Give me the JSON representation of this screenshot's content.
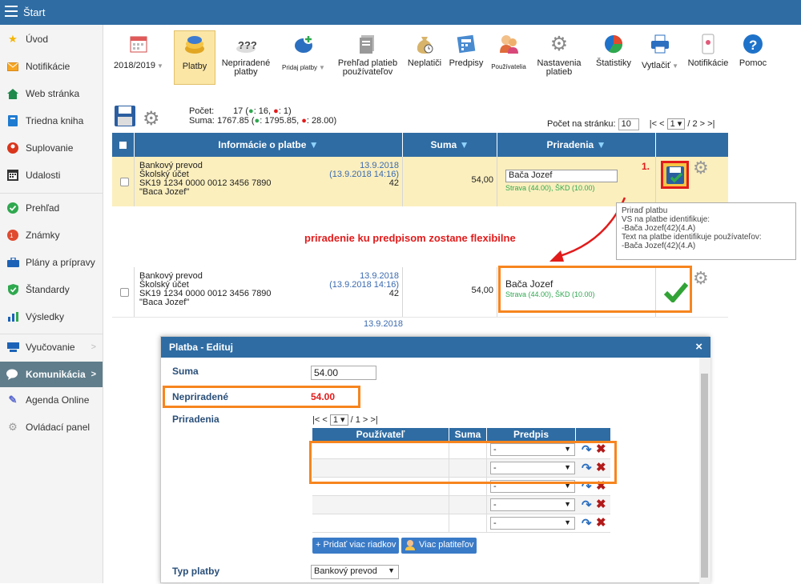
{
  "topbar": {
    "title": "Štart"
  },
  "sidebar": {
    "items": [
      {
        "label": "Úvod",
        "icon": "star-icon"
      },
      {
        "label": "Notifikácie",
        "icon": "envelope-icon"
      },
      {
        "label": "Web stránka",
        "icon": "home-icon"
      },
      {
        "label": "Triedna kniha",
        "icon": "book-icon"
      },
      {
        "label": "Suplovanie",
        "icon": "user-swap-icon"
      },
      {
        "label": "Udalosti",
        "icon": "calendar-icon"
      },
      {
        "label": "Prehľad",
        "icon": "check-circle-icon"
      },
      {
        "label": "Známky",
        "icon": "grades-icon"
      },
      {
        "label": "Plány a prípravy",
        "icon": "briefcase-icon"
      },
      {
        "label": "Štandardy",
        "icon": "shield-check-icon"
      },
      {
        "label": "Výsledky",
        "icon": "bar-chart-icon"
      },
      {
        "label": "Vyučovanie",
        "icon": "classroom-icon"
      },
      {
        "label": "Komunikácia",
        "icon": "chat-icon"
      },
      {
        "label": "Agenda Online",
        "icon": "pen-icon"
      },
      {
        "label": "Ovládací panel",
        "icon": "gear-icon"
      }
    ]
  },
  "toolbar": {
    "year": "2018/2019",
    "platby": "Platby",
    "nepriradene": "Nepriradené platby",
    "pridaj": "Pridaj platby",
    "prehlad": "Prehľad platieb používateľov",
    "neplatici": "Neplatiči",
    "predpisy": "Predpisy",
    "pouzivatelia": "Používatelia",
    "nastavenia": "Nastavenia platieb",
    "statistiky": "Štatistiky",
    "vytlacit": "Vytlačiť",
    "notifikacie": "Notifikácie",
    "pomoc": "Pomoc"
  },
  "summary": {
    "pocet_label": "Počet:",
    "pocet_value": "17 (",
    "pocet_plus": ": 16, ",
    "pocet_minus": ": 1)",
    "suma_label": "Suma:",
    "suma_value": "1767.85 (",
    "suma_plus": ": 1795.85, ",
    "suma_minus": ": 28.00)",
    "per_page_label": "Počet na stránku:",
    "per_page": "10",
    "page_first": "|<",
    "page_prev": "<",
    "page_current": "1",
    "page_total": "/ 2",
    "page_next": ">",
    "page_last": ">|"
  },
  "grid": {
    "headers": {
      "info": "Informácie o platbe",
      "suma": "Suma",
      "priradenia": "Priradenia"
    },
    "rows": [
      {
        "type": "Bankový prevod",
        "account_name": "Školský účet",
        "iban": "SK19 1234 0000 0012 3456 7890",
        "note": "\"Baca Jozef\"",
        "date": "13.9.2018",
        "datetime": "(13.9.2018 14:16)",
        "vs": "42",
        "amount": "54,00",
        "assignee": "Bača Jozef",
        "details": "Strava (44.00), ŠKD (10.00)"
      },
      {
        "type": "Bankový prevod",
        "account_name": "Školský účet",
        "iban": "SK19 1234 0000 0012 3456 7890",
        "note": "\"Baca Jozef\"",
        "date": "13.9.2018",
        "datetime": "(13.9.2018 14:16)",
        "vs": "42",
        "amount": "54,00",
        "assignee": "Bača Jozef",
        "details": "Strava (44.00), ŠKD (10.00)"
      }
    ],
    "next_row_partial": "13.9.2018"
  },
  "annotation": {
    "step": "1.",
    "text": "priradenie ku predpisom zostane flexibilne"
  },
  "tooltip": {
    "lines": [
      "Priraď platbu",
      "VS na platbe identifikuje:",
      "-Bača Jozef(42)(4.A)",
      "Text na platbe identifikuje používateľov:",
      "-Bača Jozef(42)(4.A)"
    ]
  },
  "dialog": {
    "title": "Platba - Edituj",
    "close": "×",
    "suma_label": "Suma",
    "suma_value": "54.00",
    "nepriradene_label": "Nepriradené",
    "nepriradene_value": "54.00",
    "priradenia_label": "Priradenia",
    "pager": {
      "first": "|<",
      "prev": "<",
      "current": "1",
      "total": "/ 1",
      "next": ">",
      "last": ">|"
    },
    "cols": {
      "user": "Používateľ",
      "suma": "Suma",
      "predpis": "Predpis"
    },
    "rows": [
      {
        "predpis": "-"
      },
      {
        "predpis": "-"
      },
      {
        "predpis": "-"
      },
      {
        "predpis": "-"
      },
      {
        "predpis": "-"
      }
    ],
    "add_rows": "+ Pridať viac riadkov",
    "more_payers": "Viac platiteľov",
    "typ_label": "Typ platby",
    "typ_value": "Bankový prevod"
  },
  "colors": {
    "header_blue": "#2f6ca3",
    "selected_row": "#fbefbe",
    "orange": "#f7851e",
    "red_text": "#e21b1b",
    "green": "#32a336"
  }
}
